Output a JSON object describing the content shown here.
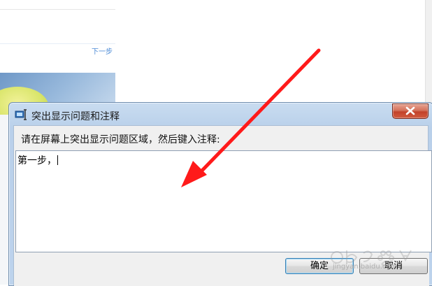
{
  "background": {
    "next_link": "下一步"
  },
  "dialog": {
    "title": "突出显示问题和注释",
    "instruction": "请在屏幕上突出显示问题区域，然后键入注释:",
    "annotation_value": "第一步，",
    "ok_label": "确定",
    "cancel_label": "取消",
    "icons": {
      "app": "problem-steps-recorder-icon",
      "close": "close-icon"
    }
  },
  "watermark": {
    "text": "jingyan.baidu.com"
  },
  "colors": {
    "arrow": "#ff1a1a",
    "title_bar": "#c9dcf0",
    "close_button": "#c2422a"
  }
}
